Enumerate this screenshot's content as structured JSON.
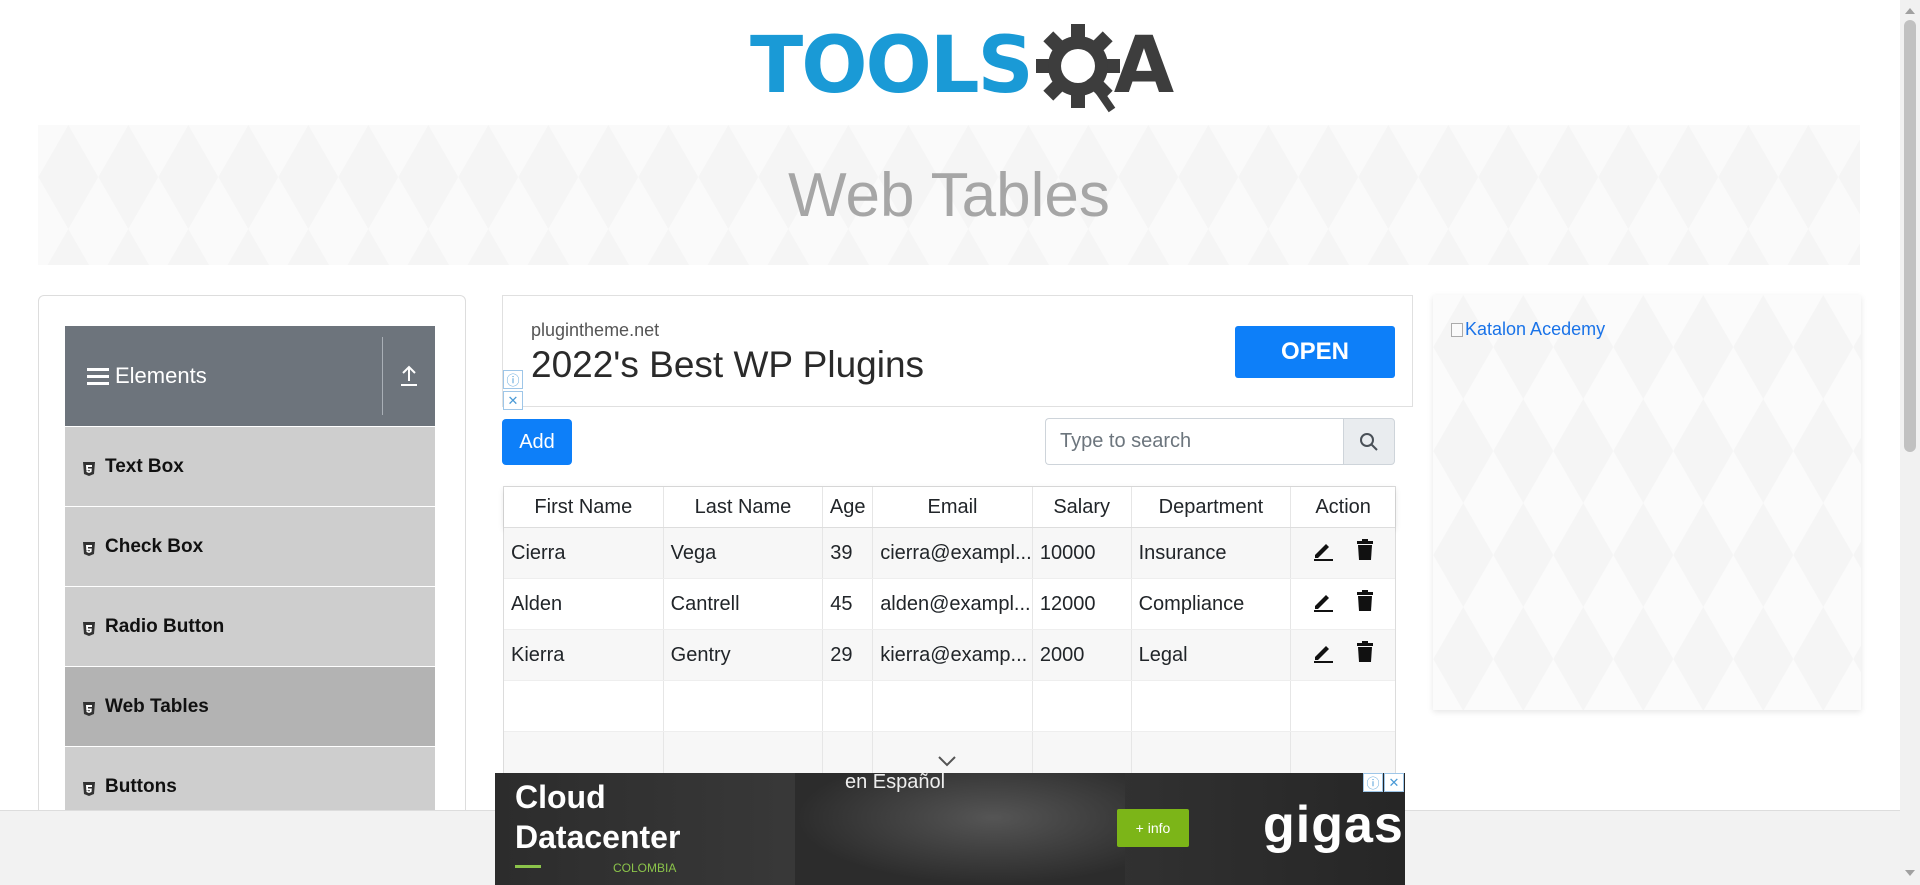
{
  "logo": {
    "part1": "TOOLS",
    "part2": "A"
  },
  "banner": {
    "title": "Web Tables"
  },
  "sidebar": {
    "header": "Elements",
    "items": [
      {
        "label": "Text Box"
      },
      {
        "label": "Check Box"
      },
      {
        "label": "Radio Button"
      },
      {
        "label": "Web Tables",
        "active": true
      },
      {
        "label": "Buttons"
      }
    ]
  },
  "ad_top": {
    "domain": "plugintheme.net",
    "headline": "2022's Best WP Plugins",
    "button": "OPEN"
  },
  "toolbar": {
    "add_label": "Add",
    "search_placeholder": "Type to search"
  },
  "table": {
    "headers": [
      "First Name",
      "Last Name",
      "Age",
      "Email",
      "Salary",
      "Department",
      "Action"
    ],
    "rows": [
      [
        "Cierra",
        "Vega",
        "39",
        "cierra@exampl...",
        "10000",
        "Insurance"
      ],
      [
        "Alden",
        "Cantrell",
        "45",
        "alden@exampl...",
        "12000",
        "Compliance"
      ],
      [
        "Kierra",
        "Gentry",
        "29",
        "kierra@examp...",
        "2000",
        "Legal"
      ]
    ]
  },
  "right_ad": {
    "alt_text": "Katalon Acedemy"
  },
  "bottom_ad": {
    "line1": "Cloud",
    "line2": "Datacenter",
    "overlay_text": "en Español",
    "country": "COLOMBIA",
    "info_button": "+ info",
    "brand": "gigas"
  },
  "colors": {
    "primary": "#0d7ff9",
    "logo_blue": "#1a9ad6",
    "sidebar_header": "#6d747c",
    "menu_item": "#cecece",
    "menu_active": "#b3b3b3"
  }
}
